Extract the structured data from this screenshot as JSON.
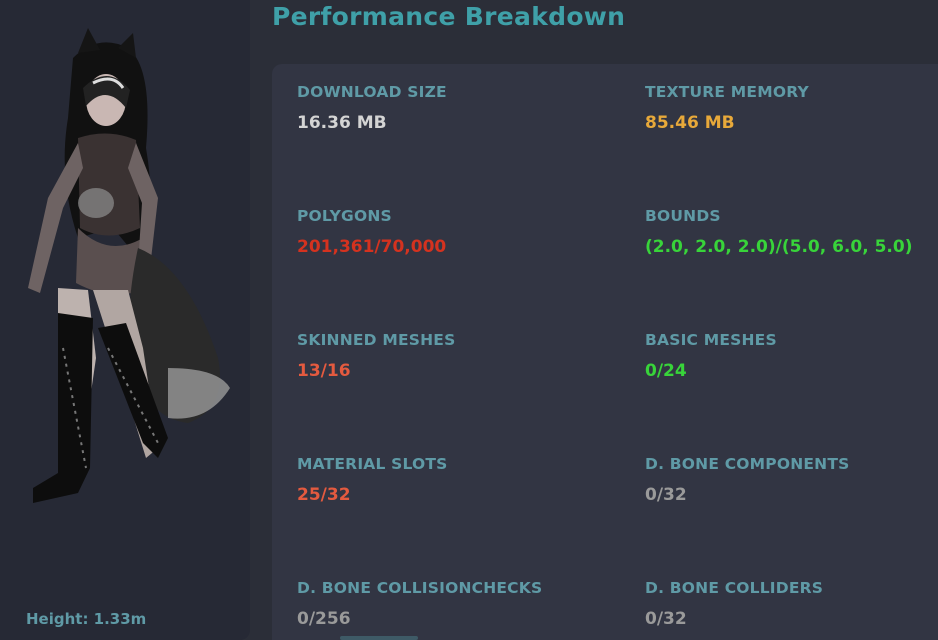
{
  "page": {
    "title": "Performance Breakdown"
  },
  "avatar": {
    "height_label": "Height: 1.33m"
  },
  "stats": [
    {
      "label": "DOWNLOAD SIZE",
      "value": "16.36 MB",
      "color": "#d4d4d4"
    },
    {
      "label": "TEXTURE MEMORY",
      "value": "85.46 MB",
      "color": "#e8a93a"
    },
    {
      "label": "POLYGONS",
      "value": "201,361/70,000",
      "color": "#d4321f"
    },
    {
      "label": "BOUNDS",
      "value": "(2.0, 2.0, 2.0)/(5.0, 6.0, 5.0)",
      "color": "#38d43a"
    },
    {
      "label": "SKINNED MESHES",
      "value": "13/16",
      "color": "#e45a3f"
    },
    {
      "label": "BASIC MESHES",
      "value": "0/24",
      "color": "#38d43a"
    },
    {
      "label": "MATERIAL SLOTS",
      "value": "25/32",
      "color": "#e45a3f"
    },
    {
      "label": "D. BONE COMPONENTS",
      "value": "0/32",
      "color": "#9a9a9a"
    },
    {
      "label": "D. BONE COLLISIONCHECKS",
      "value": "0/256",
      "color": "#9a9a9a"
    },
    {
      "label": "D. BONE COLLIDERS",
      "value": "0/32",
      "color": "#9a9a9a"
    }
  ]
}
